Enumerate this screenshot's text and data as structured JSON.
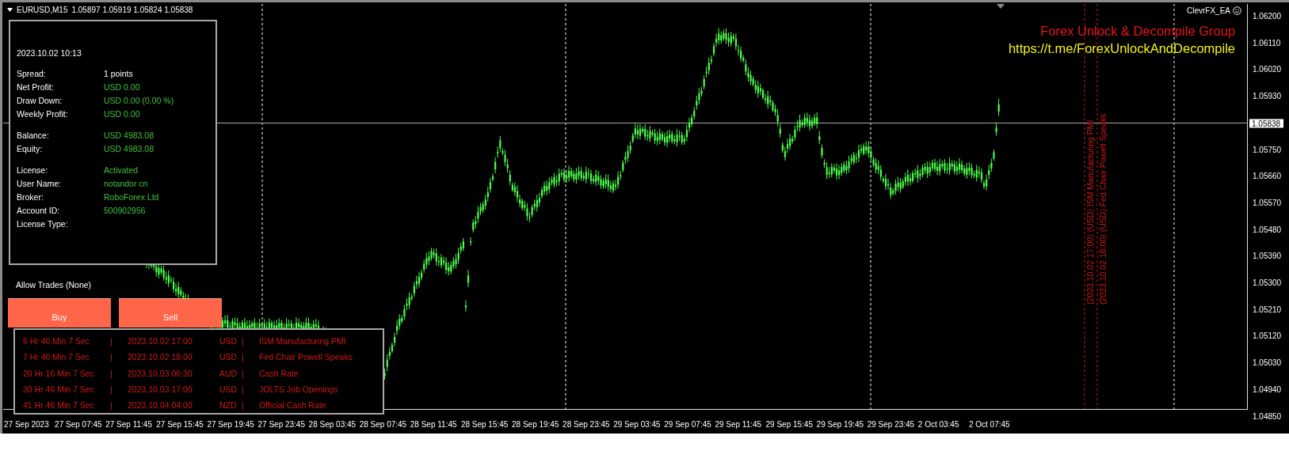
{
  "chart_header": {
    "symbol": "EURUSD,M15",
    "quote": "1.05897 1.05919 1.05824 1.05838"
  },
  "expert": {
    "name": "ClevrFX_EA"
  },
  "banner": {
    "title": "Forex Unlock & Decompile Group",
    "link": "https://t.me/ForexUnlockAndDecompile"
  },
  "info_panel": {
    "timestamp": "2023.10.02 10:13",
    "groups": [
      [
        {
          "label": "Spread:",
          "value": "1 points",
          "kind": "neutral"
        },
        {
          "label": "Net Profit:",
          "value": "USD 0.00",
          "kind": "positive"
        },
        {
          "label": "Draw Down:",
          "value": "USD 0.00 (0.00 %)",
          "kind": "positive"
        },
        {
          "label": "Weekly Profit:",
          "value": "USD 0.00",
          "kind": "positive"
        }
      ],
      [
        {
          "label": "Balance:",
          "value": "USD 4983.08",
          "kind": "positive"
        },
        {
          "label": "Equity:",
          "value": "USD 4983.08",
          "kind": "positive"
        }
      ],
      [
        {
          "label": "License:",
          "value": "Activated",
          "kind": "positive"
        },
        {
          "label": "User Name:",
          "value": "notandor cn",
          "kind": "positive"
        },
        {
          "label": "Broker:",
          "value": "RoboForex Ltd",
          "kind": "positive"
        },
        {
          "label": "Account ID:",
          "value": "500902956",
          "kind": "positive"
        },
        {
          "label": "License Type:"
        }
      ]
    ]
  },
  "allow_trades": "Allow Trades (None)",
  "buttons": [
    "Buy",
    "Sell"
  ],
  "events": [
    {
      "countdown": "6 Hr 46 Min 7 Sec",
      "separators": [
        "|",
        "|"
      ],
      "time": "2023.10.02 17:00",
      "currency": "USD",
      "title": "ISM Manufacturing PMI"
    },
    {
      "countdown": "7 Hr 46 Min 7 Sec",
      "separators": [
        "|",
        "|"
      ],
      "time": "2023.10.02 18:00",
      "currency": "USD",
      "title": "Fed Chair Powell Speaks"
    },
    {
      "countdown": "20 Hr 16 Min 7 Sec",
      "separators": [
        "|",
        "|"
      ],
      "time": "2023.10.03 06:30",
      "currency": "AUD",
      "title": "Cash Rate"
    },
    {
      "countdown": "30 Hr 46 Min 7 Sec",
      "separators": [
        "|",
        "|"
      ],
      "time": "2023.10.03 17:00",
      "currency": "USD",
      "title": "JOLTS Job Openings"
    },
    {
      "countdown": "41 Hr 46 Min 7 Sec",
      "separators": [
        "|",
        "|"
      ],
      "time": "2023.10.04 04:00",
      "currency": "NZD",
      "title": "Official Cash Rate"
    }
  ],
  "event_markers": [
    {
      "label": "(2023.10.02 17:00) (USD) ISM Manufacturing PMI"
    },
    {
      "label": "(2023.10.02 18:00) (USD) Fed Chair Powell Speaks"
    }
  ],
  "price_axis": {
    "labels": [
      "1.06200",
      "1.06110",
      "1.06020",
      "1.05930",
      "1.05750",
      "1.05660",
      "1.05570",
      "1.05480",
      "1.05390",
      "1.05300",
      "1.05210",
      "1.05120",
      "1.05030",
      "1.04940",
      "1.04850"
    ],
    "current": "1.05838"
  },
  "time_axis": {
    "labels": [
      "27 Sep 2023",
      "27 Sep 07:45",
      "27 Sep 11:45",
      "27 Sep 15:45",
      "27 Sep 19:45",
      "27 Sep 23:45",
      "28 Sep 03:45",
      "28 Sep 07:45",
      "28 Sep 11:45",
      "28 Sep 15:45",
      "28 Sep 19:45",
      "28 Sep 23:45",
      "29 Sep 03:45",
      "29 Sep 07:45",
      "29 Sep 11:45",
      "29 Sep 15:45",
      "29 Sep 19:45",
      "29 Sep 23:45",
      "2 Oct 03:45",
      "2 Oct 07:45"
    ]
  }
}
